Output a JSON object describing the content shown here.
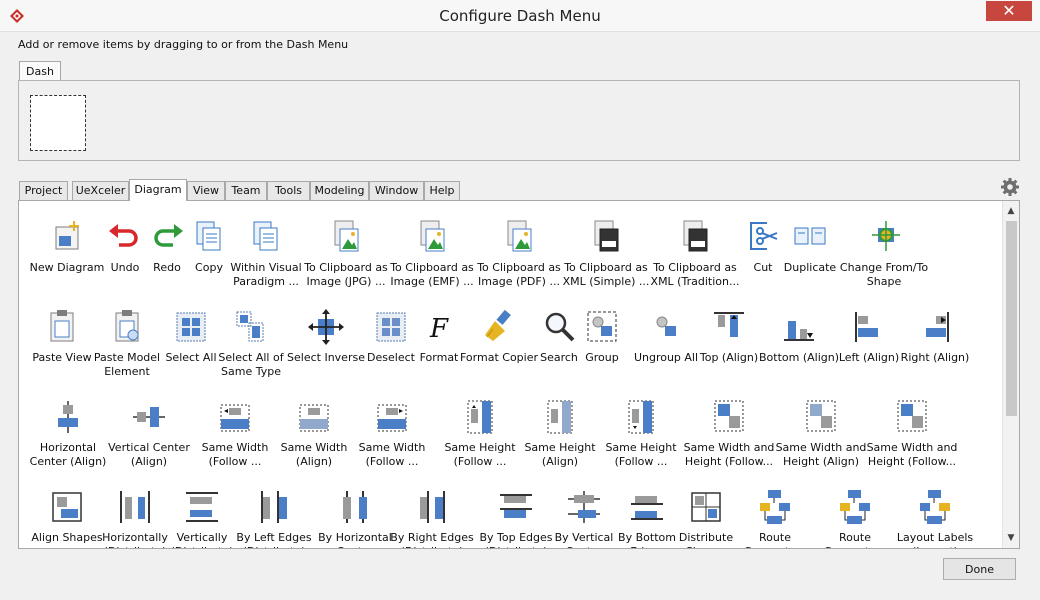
{
  "window": {
    "title": "Configure Dash Menu",
    "close_glyph": "✕",
    "icon": "diamond-logo-icon"
  },
  "instruction": "Add or remove items by dragging to or from the Dash Menu",
  "dash_tab": "Dash",
  "tabs": [
    "Project",
    "UeXceler",
    "Diagram",
    "View",
    "Team",
    "Tools",
    "Modeling",
    "Window",
    "Help"
  ],
  "active_tab": "Diagram",
  "buttons": {
    "done": "Done"
  },
  "items": [
    {
      "label": "New Diagram",
      "icon": "new-diagram-icon"
    },
    {
      "label": "Undo",
      "icon": "undo-icon"
    },
    {
      "label": "Redo",
      "icon": "redo-icon"
    },
    {
      "label": "Copy",
      "icon": "copy-icon"
    },
    {
      "label": "Within Visual\nParadigm ...",
      "icon": "copy-within-icon"
    },
    {
      "label": "To Clipboard as\nImage (JPG) ...",
      "icon": "clipboard-jpg-icon"
    },
    {
      "label": "To Clipboard as\nImage (EMF) ...",
      "icon": "clipboard-emf-icon"
    },
    {
      "label": "To Clipboard as\nImage (PDF) ...",
      "icon": "clipboard-pdf-icon"
    },
    {
      "label": "To Clipboard as\nXML (Simple) ...",
      "icon": "clipboard-xml-simple-icon"
    },
    {
      "label": "To Clipboard as\nXML (Tradition...",
      "icon": "clipboard-xml-traditional-icon"
    },
    {
      "label": "Cut",
      "icon": "cut-icon"
    },
    {
      "label": "Duplicate",
      "icon": "duplicate-icon"
    },
    {
      "label": "Change From/To\nShape",
      "icon": "change-shape-icon"
    },
    {
      "label": "Paste View",
      "icon": "paste-view-icon"
    },
    {
      "label": "Paste Model\nElement",
      "icon": "paste-model-icon"
    },
    {
      "label": "Select All",
      "icon": "select-all-icon"
    },
    {
      "label": "Select All of\nSame Type",
      "icon": "select-same-type-icon"
    },
    {
      "label": "Select Inverse",
      "icon": "select-inverse-icon"
    },
    {
      "label": "Deselect",
      "icon": "deselect-icon"
    },
    {
      "label": "Format",
      "icon": "format-icon"
    },
    {
      "label": "Format Copier",
      "icon": "format-copier-icon"
    },
    {
      "label": "Search",
      "icon": "search-icon"
    },
    {
      "label": "Group",
      "icon": "group-icon"
    },
    {
      "label": "Ungroup All",
      "icon": "ungroup-icon"
    },
    {
      "label": "Top (Align)",
      "icon": "align-top-icon"
    },
    {
      "label": "Bottom (Align)",
      "icon": "align-bottom-icon"
    },
    {
      "label": "Left (Align)",
      "icon": "align-left-icon"
    },
    {
      "label": "Right (Align)",
      "icon": "align-right-icon"
    },
    {
      "label": "Horizontal\nCenter (Align)",
      "icon": "align-h-center-icon"
    },
    {
      "label": "Vertical Center\n(Align)",
      "icon": "align-v-center-icon"
    },
    {
      "label": "Same Width\n(Follow ...",
      "icon": "same-width-follow-icon"
    },
    {
      "label": "Same Width\n(Align)",
      "icon": "same-width-align-icon"
    },
    {
      "label": "Same Width\n(Follow ...",
      "icon": "same-width-follow-2-icon"
    },
    {
      "label": "Same Height\n(Follow ...",
      "icon": "same-height-follow-icon"
    },
    {
      "label": "Same Height\n(Align)",
      "icon": "same-height-align-icon"
    },
    {
      "label": "Same Height\n(Follow ...",
      "icon": "same-height-follow-2-icon"
    },
    {
      "label": "Same Width and\nHeight (Follow...",
      "icon": "same-size-follow-icon"
    },
    {
      "label": "Same Width and\nHeight (Align)",
      "icon": "same-size-align-icon"
    },
    {
      "label": "Same Width and\nHeight (Follow...",
      "icon": "same-size-follow-2-icon"
    },
    {
      "label": "Align Shapes",
      "icon": "align-shapes-icon"
    },
    {
      "label": "Horizontally\n(Distribute)",
      "icon": "distribute-horizontal-icon"
    },
    {
      "label": "Vertically\n(Distribute)",
      "icon": "distribute-vertical-icon"
    },
    {
      "label": "By Left Edges\n(Distribute)",
      "icon": "distribute-left-icon"
    },
    {
      "label": "By Horizontal\nCenter",
      "icon": "distribute-h-center-icon"
    },
    {
      "label": "By Right Edges\n(Distribute)",
      "icon": "distribute-right-icon"
    },
    {
      "label": "By Top Edges\n(Distribute)",
      "icon": "distribute-top-icon"
    },
    {
      "label": "By Vertical\nCenter",
      "icon": "distribute-v-center-icon"
    },
    {
      "label": "By Bottom\nEdges",
      "icon": "distribute-bottom-icon"
    },
    {
      "label": "Distribute\nShapes",
      "icon": "distribute-shapes-icon"
    },
    {
      "label": "Route\nConnectors",
      "icon": "route-connectors-icon"
    },
    {
      "label": "Route\nConnectors",
      "icon": "route-connectors-2-icon"
    },
    {
      "label": "Layout Labels\n(Layout)",
      "icon": "layout-labels-icon"
    }
  ]
}
